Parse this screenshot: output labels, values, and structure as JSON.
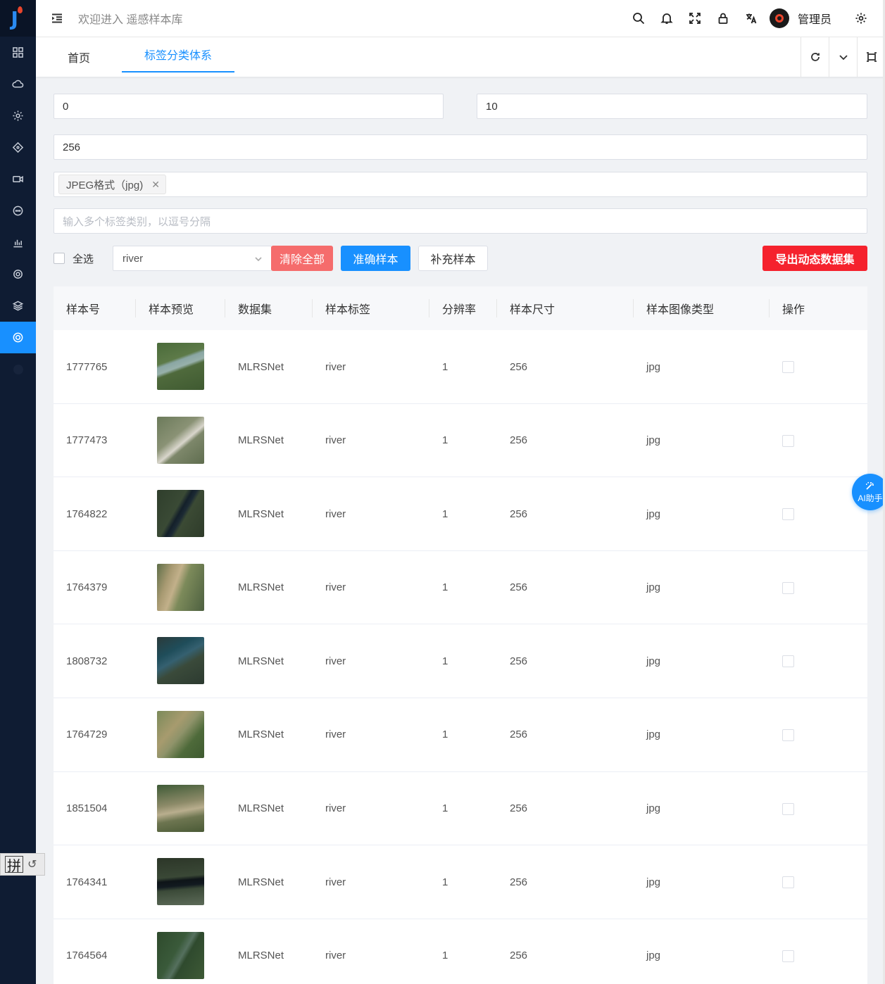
{
  "header": {
    "welcome": "欢迎进入 遥感样本库",
    "username": "管理员"
  },
  "tabs": [
    {
      "label": "首页"
    },
    {
      "label": "标签分类体系"
    }
  ],
  "filters": {
    "field_a": "0",
    "field_b": "10",
    "size": "256",
    "format_tag": "JPEG格式（jpg)",
    "labels_placeholder": "输入多个标签类别，以逗号分隔"
  },
  "toolbar": {
    "select_all": "全选",
    "select_value": "river",
    "clear_all": "清除全部",
    "accurate": "准确样本",
    "supplement": "补充样本",
    "export": "导出动态数据集"
  },
  "table": {
    "columns": [
      "样本号",
      "样本预览",
      "数据集",
      "样本标签",
      "分辨率",
      "样本尺寸",
      "样本图像类型",
      "操作"
    ],
    "rows": [
      {
        "id": "1777765",
        "dataset": "MLRSNet",
        "label": "river",
        "resolution": "1",
        "size": "256",
        "type": "jpg"
      },
      {
        "id": "1777473",
        "dataset": "MLRSNet",
        "label": "river",
        "resolution": "1",
        "size": "256",
        "type": "jpg"
      },
      {
        "id": "1764822",
        "dataset": "MLRSNet",
        "label": "river",
        "resolution": "1",
        "size": "256",
        "type": "jpg"
      },
      {
        "id": "1764379",
        "dataset": "MLRSNet",
        "label": "river",
        "resolution": "1",
        "size": "256",
        "type": "jpg"
      },
      {
        "id": "1808732",
        "dataset": "MLRSNet",
        "label": "river",
        "resolution": "1",
        "size": "256",
        "type": "jpg"
      },
      {
        "id": "1764729",
        "dataset": "MLRSNet",
        "label": "river",
        "resolution": "1",
        "size": "256",
        "type": "jpg"
      },
      {
        "id": "1851504",
        "dataset": "MLRSNet",
        "label": "river",
        "resolution": "1",
        "size": "256",
        "type": "jpg"
      },
      {
        "id": "1764341",
        "dataset": "MLRSNet",
        "label": "river",
        "resolution": "1",
        "size": "256",
        "type": "jpg"
      },
      {
        "id": "1764564",
        "dataset": "MLRSNet",
        "label": "river",
        "resolution": "1",
        "size": "256",
        "type": "jpg"
      }
    ]
  },
  "ai_assistant": "AI助手",
  "ime": {
    "mode": "拼"
  },
  "colors": {
    "sidebar": "#0f1c33",
    "accent": "#1890ff",
    "danger": "#f56c6c",
    "export": "#f5222d"
  }
}
